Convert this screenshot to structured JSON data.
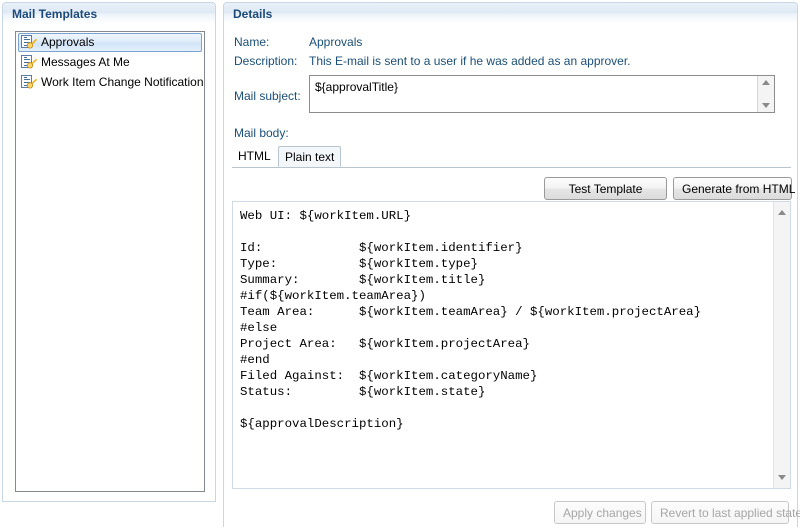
{
  "left_panel": {
    "title": "Mail Templates",
    "items": [
      {
        "label": "Approvals",
        "selected": true
      },
      {
        "label": "Messages At Me",
        "selected": false
      },
      {
        "label": "Work Item Change Notification",
        "selected": false
      }
    ]
  },
  "details": {
    "title": "Details",
    "name_label": "Name:",
    "name_value": "Approvals",
    "description_label": "Description:",
    "description_value": "This E-mail is sent to a user if he was added as an approver.",
    "subject_label": "Mail subject:",
    "subject_value": "${approvalTitle}",
    "body_label": "Mail body:",
    "tabs": [
      {
        "label": "HTML",
        "active": false
      },
      {
        "label": "Plain text",
        "active": true
      }
    ],
    "test_template_label": "Test Template",
    "generate_from_html_label": "Generate from HTML",
    "body_text": "Web UI: ${workItem.URL}\n\nId:             ${workItem.identifier}\nType:           ${workItem.type}\nSummary:        ${workItem.title}\n#if(${workItem.teamArea})\nTeam Area:      ${workItem.teamArea} / ${workItem.projectArea}\n#else\nProject Area:   ${workItem.projectArea}\n#end\nFiled Against:  ${workItem.categoryName}\nStatus:         ${workItem.state}\n\n${approvalDescription}"
  },
  "footer": {
    "apply_label": "Apply changes",
    "revert_label": "Revert to last applied state"
  },
  "colors": {
    "header_text": "#1d4a7a",
    "field_text": "#1b4f77",
    "panel_border": "#c9d7e4",
    "selection_border": "#7da2ce",
    "icon_key": "#f0b429"
  }
}
